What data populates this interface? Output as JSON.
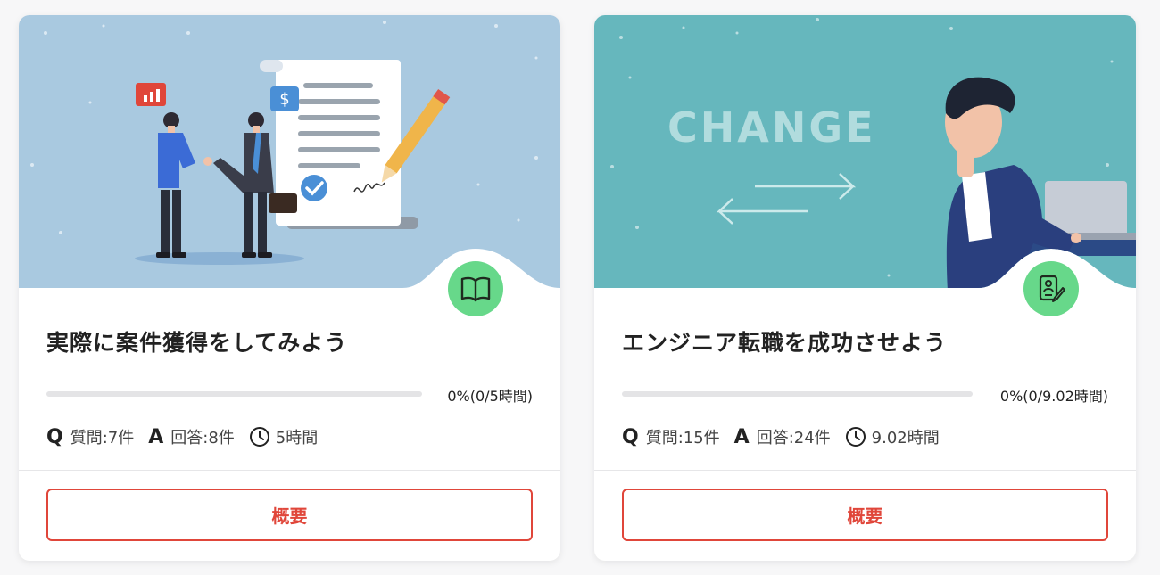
{
  "colors": {
    "accent": "#e0463a",
    "badge": "#67d88a",
    "card1_bg": "#a9c9e0",
    "card2_bg": "#66b7bd"
  },
  "cards": [
    {
      "title": "実際に案件獲得をしてみよう",
      "badge_icon": "open-book-icon",
      "progress_fraction": 0,
      "progress_text": "0%(0/5時間)",
      "stats": {
        "q_letter": "Q",
        "questions": "質問:7件",
        "a_letter": "A",
        "answers": "回答:8件",
        "hours": "5時間"
      },
      "button_label": "概要"
    },
    {
      "title": "エンジニア転職を成功させよう",
      "badge_icon": "resume-edit-icon",
      "hero_text": "CHANGE",
      "progress_fraction": 0,
      "progress_text": "0%(0/9.02時間)",
      "stats": {
        "q_letter": "Q",
        "questions": "質問:15件",
        "a_letter": "A",
        "answers": "回答:24件",
        "hours": "9.02時間"
      },
      "button_label": "概要"
    }
  ]
}
